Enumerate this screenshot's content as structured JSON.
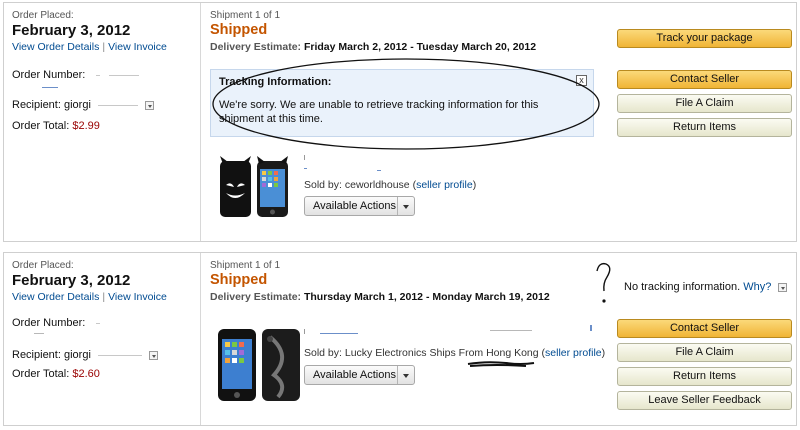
{
  "orders": [
    {
      "placed_label": "Order Placed:",
      "placed_date": "February 3, 2012",
      "view_details": "View Order Details",
      "separator": "|",
      "view_invoice": "View Invoice",
      "order_number_label": "Order Number:",
      "recipient_label": "Recipient:",
      "recipient_name": "giorgi",
      "total_label": "Order Total:",
      "total_value": "$2.99",
      "shipment_label": "Shipment 1 of 1",
      "status": "Shipped",
      "delivery_label": "Delivery Estimate:",
      "delivery_value": "Friday March 2, 2012 - Tuesday March 20, 2012",
      "tracking_title": "Tracking Information:",
      "tracking_message": "We're sorry. We are unable to retrieve tracking information for this shipment at this time.",
      "tracking_close": "x",
      "sold_by_label": "Sold by: ceworldhouse",
      "seller_profile_open": "(",
      "seller_profile_link": "seller profile",
      "seller_profile_close": ")",
      "available_actions": "Available Actions",
      "buttons": [
        "Track your package",
        "Contact Seller",
        "File A Claim",
        "Return Items"
      ]
    },
    {
      "placed_label": "Order Placed:",
      "placed_date": "February 3, 2012",
      "view_details": "View Order Details",
      "separator": "|",
      "view_invoice": "View Invoice",
      "order_number_label": "Order Number:",
      "recipient_label": "Recipient:",
      "recipient_name": "giorgi",
      "total_label": "Order Total:",
      "total_value": "$2.60",
      "shipment_label": "Shipment 1 of 1",
      "status": "Shipped",
      "delivery_label": "Delivery Estimate:",
      "delivery_value": "Thursday March 1, 2012 - Monday March 19, 2012",
      "no_tracking_text": "No tracking information.",
      "why_link": "Why?",
      "sold_by_label": "Sold by: Lucky Electronics Ships From Hong Kong",
      "seller_profile_open": "(",
      "seller_profile_link": "seller profile",
      "seller_profile_close": ")",
      "available_actions": "Available Actions",
      "buttons": [
        "Contact Seller",
        "File A Claim",
        "Return Items",
        "Leave Seller Feedback"
      ]
    }
  ],
  "icons": {
    "close": "close-icon",
    "dropdown": "chevron-down-icon",
    "product1": "iphone-case-devil-image",
    "product2": "iphone-case-black-image"
  },
  "colors": {
    "link": "#004b91",
    "status": "#c45500",
    "price": "#990000",
    "primary_button": "#f0b435",
    "secondary_button": "#e6e6cc",
    "tracking_box": "#eaf2fb"
  }
}
